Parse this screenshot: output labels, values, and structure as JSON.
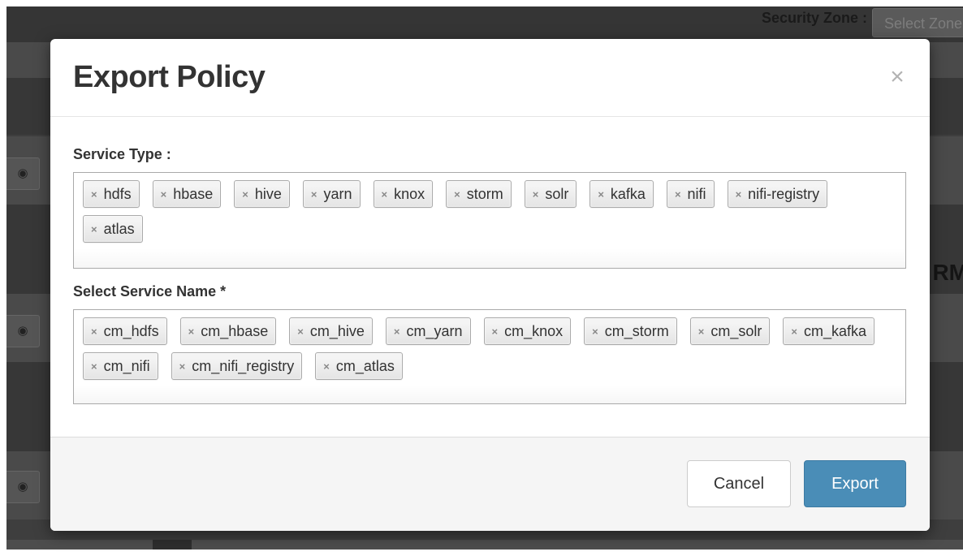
{
  "background": {
    "security_zone_label": "Security Zone :",
    "security_zone_placeholder": "Select Zone",
    "partial_heading_text": "RM",
    "eye_icon": "eye-icon"
  },
  "modal": {
    "title": "Export Policy",
    "close_symbol": "×",
    "service_type": {
      "label": "Service Type :",
      "chips": [
        "hdfs",
        "hbase",
        "hive",
        "yarn",
        "knox",
        "storm",
        "solr",
        "kafka",
        "nifi",
        "nifi-registry",
        "atlas"
      ]
    },
    "service_name": {
      "label": "Select Service Name *",
      "chips": [
        "cm_hdfs",
        "cm_hbase",
        "cm_hive",
        "cm_yarn",
        "cm_knox",
        "cm_storm",
        "cm_solr",
        "cm_kafka",
        "cm_nifi",
        "cm_nifi_registry",
        "cm_atlas"
      ]
    },
    "chip_remove_symbol": "×",
    "footer": {
      "cancel_label": "Cancel",
      "export_label": "Export"
    }
  },
  "colors": {
    "primary_button": "#4a8db7",
    "overlay": "#3e3e3e"
  }
}
